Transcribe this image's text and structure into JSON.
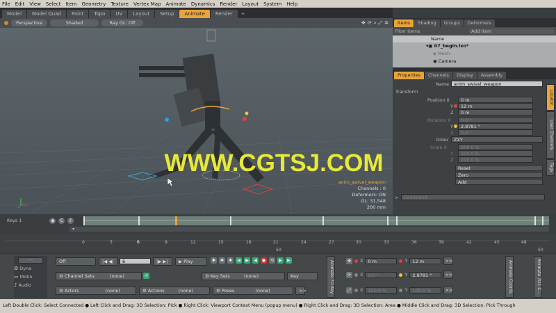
{
  "menu": [
    "File",
    "Edit",
    "View",
    "Select",
    "Item",
    "Geometry",
    "Texture",
    "Vertex Map",
    "Animate",
    "Dynamics",
    "Render",
    "Layout",
    "System",
    "Help"
  ],
  "layout_tabs": [
    "Model",
    "Model Quad",
    "Paint",
    "Topo",
    "UV",
    "Layout",
    "Setup",
    "Animate",
    "Render"
  ],
  "layout_plus": "+",
  "viewport": {
    "view": "Perspective",
    "shading": "Shaded",
    "raygl": "Ray GL: Off",
    "watermark": "WWW.CGTSJ.COM",
    "info": {
      "name": "anim_swivel_weapon",
      "channels": "Channels : 0",
      "deformers": "Deformers: ON",
      "gl": "GL: 31,548",
      "size": "200 mm"
    }
  },
  "right_tabs": [
    "Items",
    "Shading",
    "Groups",
    "Deformers"
  ],
  "items": {
    "filter": "Filter Items",
    "add": "Add Item",
    "col_name": "Name",
    "rows": [
      "07_begin.lxo*",
      "Mesh",
      "Camera"
    ]
  },
  "prop_tabs": [
    "Properties",
    "Channels",
    "Display",
    "Assembly"
  ],
  "props": {
    "name_label": "Name",
    "name_value": "anim_swivel_weapon",
    "section": "Transform",
    "pos_label": "Position X",
    "pos": [
      "0 m",
      "12 m",
      "0 m"
    ],
    "rot_label": "Rotation X",
    "rot": [
      "0.0 °",
      "2.8781 °",
      "0.0 °"
    ],
    "order_label": "Order",
    "order": "ZXY",
    "scale_label": "Scale X",
    "scale": [
      "100.0 %",
      "100.0 %",
      "100.0 %"
    ],
    "y": "Y",
    "z": "Z",
    "reset": "Reset",
    "zero": "Zero",
    "add": "Add",
    "command_placeholder": "Command"
  },
  "side_tabs": [
    "Locator",
    "User Channels",
    "Tags"
  ],
  "timeline": {
    "keys": "Keys 1",
    "ticks": [
      "0",
      "3",
      "6",
      "9",
      "12",
      "15",
      "18",
      "21",
      "24",
      "27",
      "30",
      "33",
      "36",
      "39",
      "42",
      "45",
      "48"
    ],
    "mid": "50",
    "end": "50"
  },
  "transport": {
    "mode": "Off",
    "frame": "6",
    "play": "Play"
  },
  "bottom": {
    "dyna": "Dyna",
    "motio": "Motio",
    "audio": "Audio",
    "channel_sets": "Channel Sets",
    "none": "(none)",
    "key_sets": "Key Sets",
    "key": "Key",
    "actors": "Actors",
    "actions": "Actions",
    "poses": "Poses",
    "animate_key": "Animate 7D Key",
    "animate_coords": "Animate Coords",
    "animate_7d": "Animate 7D1 C...",
    "x": "X",
    "y": "Y",
    "pos": [
      "0 m",
      "12 m"
    ],
    "rot": [
      "0.0 °",
      "2.8781 °"
    ],
    "scale": [
      "100.0 %",
      "100.0 %"
    ],
    "more": ">>"
  },
  "status": "Left Double Click: Select Connected ● Left Click and Drag: 3D Selection: Pick ● Right Click: Viewport Context Menu (popup menu) ● Right Click and Drag: 3D Selection: Area ● Middle Click and Drag: 3D Selection: Pick Through"
}
